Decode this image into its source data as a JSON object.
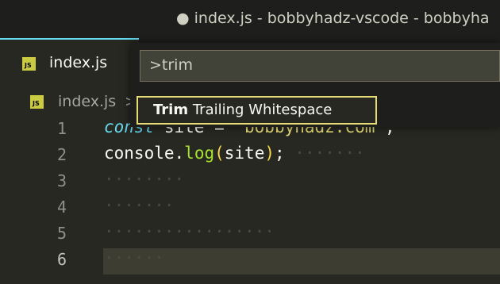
{
  "window": {
    "title": "● index.js - bobbyhadz-vscode - bobbyha"
  },
  "tab": {
    "icon": "JS",
    "label": "index.js"
  },
  "breadcrumb": {
    "icon": "JS",
    "label": "index.js",
    "separator": ">"
  },
  "editor": {
    "lines": [
      {
        "number": "1",
        "keyword": "const",
        "rest1": " site ",
        "rest2": "= ",
        "string": "'bobbyhadz.com'",
        "tail": ";"
      },
      {
        "number": "2",
        "obj": "console",
        "dot": ".",
        "fn": "log",
        "open": "(",
        "arg": "site",
        "close": ")",
        "semi": ";",
        "ws": " ·······"
      },
      {
        "number": "3",
        "ws": "········"
      },
      {
        "number": "4",
        "ws": "·······"
      },
      {
        "number": "5",
        "ws": "·················"
      },
      {
        "number": "6",
        "ws": "······"
      }
    ]
  },
  "command_palette": {
    "input_value": ">trim",
    "result_match": "Trim",
    "result_rest": " Trailing Whitespace"
  },
  "colors": {
    "background": "#272822",
    "keyword": "#66d9ef",
    "function": "#a6e22e",
    "string": "#e6db74",
    "focus_border": "#e6db74"
  }
}
